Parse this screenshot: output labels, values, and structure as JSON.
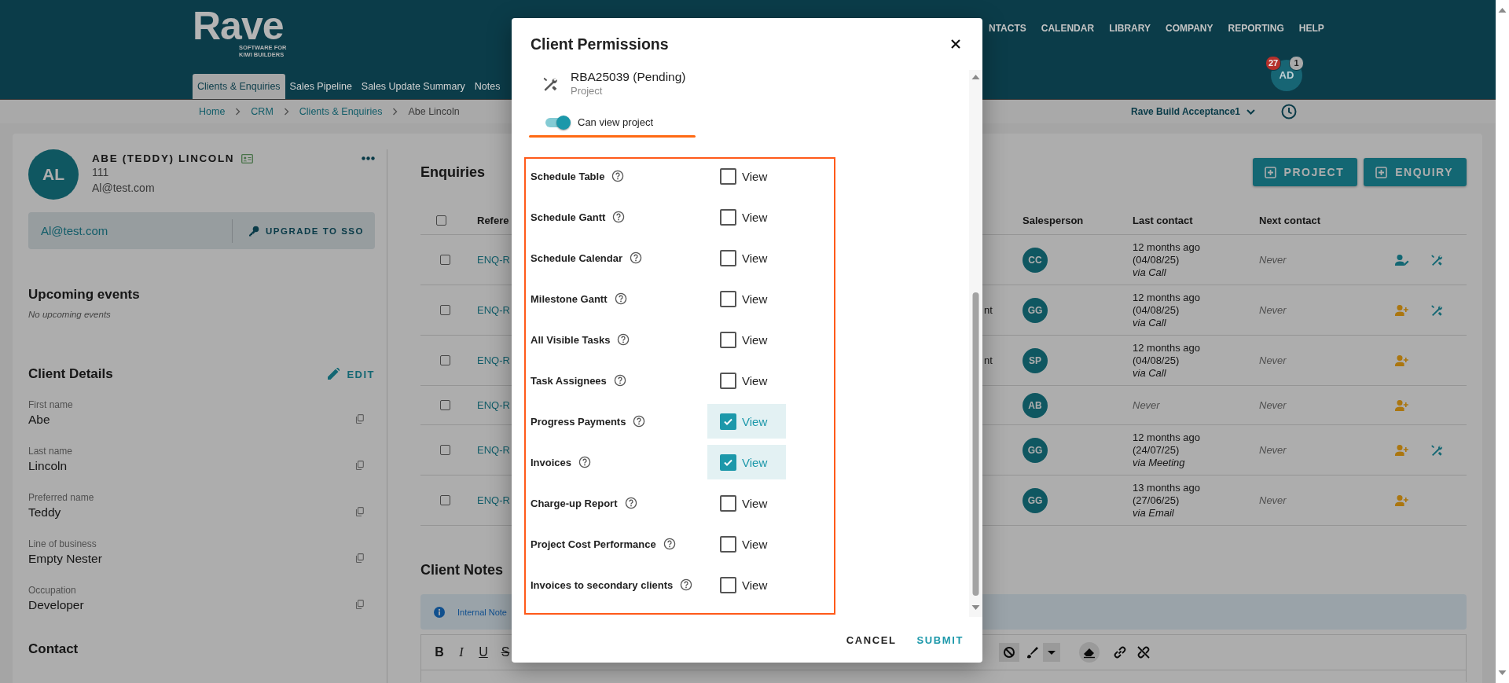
{
  "header": {
    "logo": "Rave",
    "logo_tagline": [
      "SOFTWARE FOR",
      "KIWI BUILDERS"
    ],
    "tabs": [
      {
        "label": "Clients & Enquiries",
        "selected": true
      },
      {
        "label": "Sales Pipeline",
        "selected": false
      },
      {
        "label": "Sales Update Summary",
        "selected": false
      },
      {
        "label": "Notes",
        "selected": false
      }
    ],
    "top_nav": [
      "NTACTS",
      "CALENDAR",
      "LIBRARY",
      "COMPANY",
      "REPORTING",
      "HELP"
    ],
    "user": {
      "initials": "AD",
      "badges": [
        {
          "count": "27",
          "color": "#b5302b"
        },
        {
          "count": "1",
          "color": "#a9a9a9"
        }
      ]
    }
  },
  "breadcrumb": [
    "Home",
    "CRM",
    "Clients & Enquiries",
    "Abe Lincoln"
  ],
  "workspace": "Rave Build Acceptance1",
  "client": {
    "initials": "AL",
    "name": "ABE (TEDDY) LINCOLN",
    "code": "111",
    "email": "Al@test.com",
    "login_email": "Al@test.com",
    "sso_button": "UPGRADE TO SSO"
  },
  "upcoming_events": {
    "title": "Upcoming events",
    "empty_text": "No upcoming events"
  },
  "client_details": {
    "title": "Client Details",
    "edit_button": "EDIT",
    "fields": [
      {
        "label": "First name",
        "value": "Abe"
      },
      {
        "label": "Last name",
        "value": "Lincoln"
      },
      {
        "label": "Preferred name",
        "value": "Teddy"
      },
      {
        "label": "Line of business",
        "value": "Empty Nester"
      },
      {
        "label": "Occupation",
        "value": "Developer"
      }
    ]
  },
  "contact": {
    "title": "Contact"
  },
  "enquiries": {
    "title": "Enquiries",
    "buttons": [
      "PROJECT",
      "ENQUIRY"
    ],
    "select_all": {
      "checked": false
    },
    "columns": {
      "reference": "Refere",
      "salesperson": "Salesperson",
      "last_contact": "Last contact",
      "next_contact": "Next contact"
    },
    "rows": [
      {
        "selected": false,
        "reference": "ENQ-R",
        "salesperson": "CC",
        "last_contact": {
          "kind": "contact",
          "ago": "12 months ago",
          "date": "(04/08/25)",
          "via": "via Call"
        },
        "next_contact": "Never",
        "assigned": true,
        "has_project": true
      },
      {
        "selected": false,
        "reference": "ENQ-R",
        "column_3": "nt",
        "salesperson": "GG",
        "last_contact": {
          "kind": "contact",
          "ago": "12 months ago",
          "date": "(04/08/25)",
          "via": "via Call"
        },
        "next_contact": "Never",
        "assigned": false,
        "has_project": true
      },
      {
        "selected": false,
        "reference": "ENQ-R",
        "column_3": "nt",
        "salesperson": "SP",
        "last_contact": {
          "kind": "contact",
          "ago": "12 months ago",
          "date": "(04/08/25)",
          "via": "via Call"
        },
        "next_contact": "Never",
        "assigned": false,
        "has_project": false
      },
      {
        "selected": false,
        "reference": "ENQ-R",
        "salesperson": "AB",
        "last_contact": {
          "kind": "never",
          "text": "Never"
        },
        "next_contact": "Never",
        "assigned": false,
        "has_project": false
      },
      {
        "selected": false,
        "reference": "ENQ-R",
        "salesperson": "GG",
        "last_contact": {
          "kind": "contact",
          "ago": "12 months ago",
          "date": "(24/07/25)",
          "via": "via Meeting"
        },
        "next_contact": "Never",
        "assigned": false,
        "has_project": true
      },
      {
        "selected": false,
        "reference": "ENQ-R",
        "salesperson": "GG",
        "last_contact": {
          "kind": "contact",
          "ago": "13 months ago",
          "date": "(27/06/25)",
          "via": "via Email"
        },
        "next_contact": "Never",
        "assigned": false,
        "has_project": false
      }
    ]
  },
  "client_notes": {
    "title": "Client Notes",
    "info_banner": "Internal Note",
    "format_buttons": [
      {
        "label": "B",
        "kind": "bold"
      },
      {
        "label": "I",
        "kind": "italic"
      },
      {
        "label": "U",
        "kind": "underline"
      },
      {
        "label": "S",
        "kind": "strike"
      }
    ]
  },
  "dialog": {
    "title": "Client Permissions",
    "project": {
      "name": "RBA25039 (Pending)",
      "type": "Project"
    },
    "toggle": {
      "label": "Can view project",
      "on": true
    },
    "permissions": [
      {
        "name": "Schedule Table",
        "option": "View",
        "checked": false
      },
      {
        "name": "Schedule Gantt",
        "option": "View",
        "checked": false
      },
      {
        "name": "Schedule Calendar",
        "option": "View",
        "checked": false
      },
      {
        "name": "Milestone Gantt",
        "option": "View",
        "checked": false
      },
      {
        "name": "All Visible Tasks",
        "option": "View",
        "checked": false
      },
      {
        "name": "Task Assignees",
        "option": "View",
        "checked": false
      },
      {
        "name": "Progress Payments",
        "option": "View",
        "checked": true
      },
      {
        "name": "Invoices",
        "option": "View",
        "checked": true
      },
      {
        "name": "Charge-up Report",
        "option": "View",
        "checked": false
      },
      {
        "name": "Project Cost Performance",
        "option": "View",
        "checked": false
      },
      {
        "name": "Invoices to secondary clients",
        "option": "View",
        "checked": false
      }
    ],
    "buttons": [
      "CANCEL",
      "SUBMIT"
    ]
  }
}
